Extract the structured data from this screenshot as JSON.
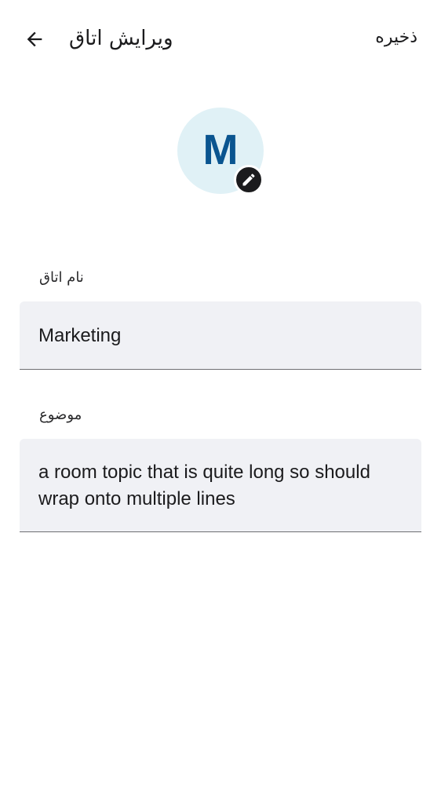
{
  "header": {
    "title": "ویرایش اتاق",
    "save_label": "ذخیره"
  },
  "avatar": {
    "letter": "M",
    "background_color": "#e0f1f6",
    "letter_color": "#0a5590"
  },
  "form": {
    "name_label": "نام اتاق",
    "name_value": "Marketing",
    "topic_label": "موضوع",
    "topic_value": "a room topic that is quite long so should wrap onto multiple lines"
  },
  "icons": {
    "back": "arrow-back-icon",
    "edit": "pencil-icon"
  }
}
